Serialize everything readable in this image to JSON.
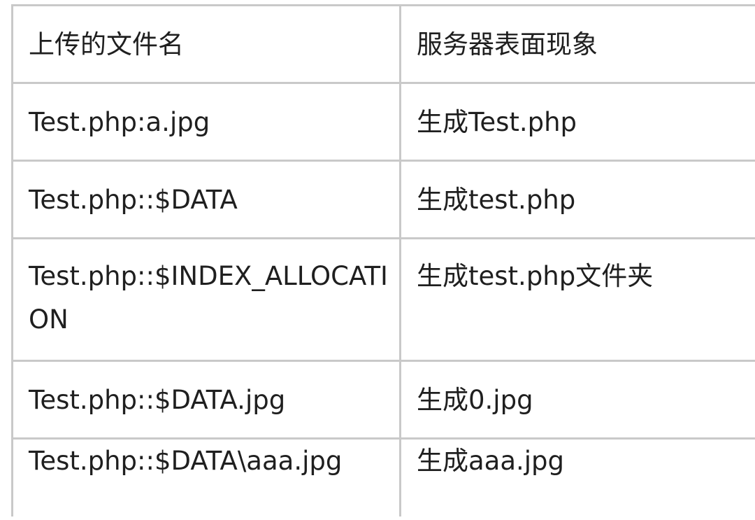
{
  "table": {
    "headers": [
      "上传的文件名",
      "服务器表面现象"
    ],
    "rows": [
      [
        "Test.php:a.jpg",
        "生成Test.php"
      ],
      [
        "Test.php::$DATA",
        "生成test.php"
      ],
      [
        "Test.php::$INDEX_ALLOCATION",
        "生成test.php文件夹"
      ],
      [
        "Test.php::$DATA.jpg",
        "生成0.jpg"
      ],
      [
        "Test.php::$DATA\\aaa.jpg",
        "生成aaa.jpg"
      ]
    ]
  },
  "colors": {
    "border": "#c9c9c9",
    "text": "#1f1f1f",
    "background": "#ffffff"
  }
}
